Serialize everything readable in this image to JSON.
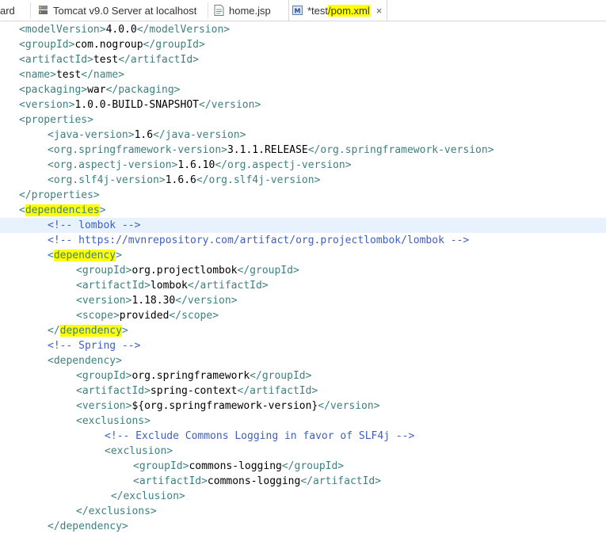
{
  "tabs": [
    {
      "label": "ard",
      "icon": "none",
      "active": false
    },
    {
      "label": "Tomcat v9.0 Server at localhost",
      "icon": "server-icon",
      "active": false
    },
    {
      "label": "home.jsp",
      "icon": "jsp-file-icon",
      "active": false
    },
    {
      "label_prefix": "*test",
      "label_highlight": "/pom.xml",
      "icon": "maven-pom-icon",
      "active": true,
      "close": "×"
    }
  ],
  "colors": {
    "tag": "#3f7f7f",
    "text": "#000000",
    "comment": "#3f5fbf",
    "highlight": "#ffff00",
    "current_line": "#e8f2fe"
  },
  "lines": [
    {
      "indent": 1,
      "parts": [
        [
          "t",
          "<modelVersion>"
        ],
        [
          "x",
          "4.0.0"
        ],
        [
          "t",
          "</modelVersion>"
        ]
      ]
    },
    {
      "indent": 1,
      "parts": [
        [
          "t",
          "<groupId>"
        ],
        [
          "x",
          "com.nogroup"
        ],
        [
          "t",
          "</groupId>"
        ]
      ]
    },
    {
      "indent": 1,
      "parts": [
        [
          "t",
          "<artifactId>"
        ],
        [
          "x",
          "test"
        ],
        [
          "t",
          "</artifactId>"
        ]
      ]
    },
    {
      "indent": 1,
      "parts": [
        [
          "t",
          "<name>"
        ],
        [
          "x",
          "test"
        ],
        [
          "t",
          "</name>"
        ]
      ]
    },
    {
      "indent": 1,
      "parts": [
        [
          "t",
          "<packaging>"
        ],
        [
          "x",
          "war"
        ],
        [
          "t",
          "</packaging>"
        ]
      ]
    },
    {
      "indent": 1,
      "parts": [
        [
          "t",
          "<version>"
        ],
        [
          "x",
          "1.0.0-BUILD-SNAPSHOT"
        ],
        [
          "t",
          "</version>"
        ]
      ]
    },
    {
      "indent": 1,
      "parts": [
        [
          "t",
          "<properties>"
        ]
      ]
    },
    {
      "indent": 2,
      "parts": [
        [
          "t",
          "<java-version>"
        ],
        [
          "x",
          "1.6"
        ],
        [
          "t",
          "</java-version>"
        ]
      ]
    },
    {
      "indent": 2,
      "parts": [
        [
          "t",
          "<org.springframework-version>"
        ],
        [
          "x",
          "3.1.1.RELEASE"
        ],
        [
          "t",
          "</org.springframework-version>"
        ]
      ]
    },
    {
      "indent": 2,
      "parts": [
        [
          "t",
          "<org.aspectj-version>"
        ],
        [
          "x",
          "1.6.10"
        ],
        [
          "t",
          "</org.aspectj-version>"
        ]
      ]
    },
    {
      "indent": 2,
      "parts": [
        [
          "t",
          "<org.slf4j-version>"
        ],
        [
          "x",
          "1.6.6"
        ],
        [
          "t",
          "</org.slf4j-version>"
        ]
      ]
    },
    {
      "indent": 1,
      "parts": [
        [
          "t",
          "</properties>"
        ]
      ]
    },
    {
      "indent": 1,
      "parts": [
        [
          "t",
          "<"
        ],
        [
          "th",
          "dependencies"
        ],
        [
          "t",
          ">"
        ]
      ]
    },
    {
      "indent": 2,
      "current": true,
      "parts": [
        [
          "c",
          "<!-- lombok -->"
        ]
      ]
    },
    {
      "indent": 2,
      "parts": [
        [
          "c",
          "<!-- https://mvnrepository.com/artifact/org.projectlombok/lombok -->"
        ]
      ]
    },
    {
      "indent": 2,
      "parts": [
        [
          "t",
          "<"
        ],
        [
          "th",
          "dependency"
        ],
        [
          "t",
          ">"
        ]
      ]
    },
    {
      "indent": 3,
      "parts": [
        [
          "t",
          "<groupId>"
        ],
        [
          "x",
          "org.projectlombok"
        ],
        [
          "t",
          "</groupId>"
        ]
      ]
    },
    {
      "indent": 3,
      "parts": [
        [
          "t",
          "<artifactId>"
        ],
        [
          "x",
          "lombok"
        ],
        [
          "t",
          "</artifactId>"
        ]
      ]
    },
    {
      "indent": 3,
      "parts": [
        [
          "t",
          "<version>"
        ],
        [
          "x",
          "1.18.30"
        ],
        [
          "t",
          "</version>"
        ]
      ]
    },
    {
      "indent": 3,
      "parts": [
        [
          "t",
          "<scope>"
        ],
        [
          "x",
          "provided"
        ],
        [
          "t",
          "</scope>"
        ]
      ]
    },
    {
      "indent": 2,
      "parts": [
        [
          "t",
          "</"
        ],
        [
          "th",
          "dependency"
        ],
        [
          "t",
          ">"
        ]
      ]
    },
    {
      "indent": 2,
      "parts": [
        [
          "c",
          "<!-- Spring -->"
        ]
      ]
    },
    {
      "indent": 2,
      "parts": [
        [
          "t",
          "<dependency>"
        ]
      ]
    },
    {
      "indent": 3,
      "parts": [
        [
          "t",
          "<groupId>"
        ],
        [
          "x",
          "org.springframework"
        ],
        [
          "t",
          "</groupId>"
        ]
      ]
    },
    {
      "indent": 3,
      "parts": [
        [
          "t",
          "<artifactId>"
        ],
        [
          "x",
          "spring-context"
        ],
        [
          "t",
          "</artifactId>"
        ]
      ]
    },
    {
      "indent": 3,
      "parts": [
        [
          "t",
          "<version>"
        ],
        [
          "x",
          "${org.springframework-version}"
        ],
        [
          "t",
          "</version>"
        ]
      ]
    },
    {
      "indent": 3,
      "parts": [
        [
          "t",
          "<exclusions>"
        ]
      ]
    },
    {
      "indent": 4,
      "parts": [
        [
          "c",
          "<!-- Exclude Commons Logging in favor of SLF4j -->"
        ]
      ]
    },
    {
      "indent": 4,
      "parts": [
        [
          "t",
          "<exclusion>"
        ]
      ]
    },
    {
      "indent": 5,
      "parts": [
        [
          "t",
          "<groupId>"
        ],
        [
          "x",
          "commons-logging"
        ],
        [
          "t",
          "</groupId>"
        ]
      ]
    },
    {
      "indent": 5,
      "parts": [
        [
          "t",
          "<artifactId>"
        ],
        [
          "x",
          "commons-logging"
        ],
        [
          "t",
          "</artifactId>"
        ]
      ]
    },
    {
      "indent": 4,
      "parts": [
        [
          "t",
          " </exclusion>"
        ]
      ]
    },
    {
      "indent": 3,
      "parts": [
        [
          "t",
          "</exclusions>"
        ]
      ]
    },
    {
      "indent": 2,
      "parts": [
        [
          "t",
          "</dependency>"
        ]
      ]
    }
  ]
}
